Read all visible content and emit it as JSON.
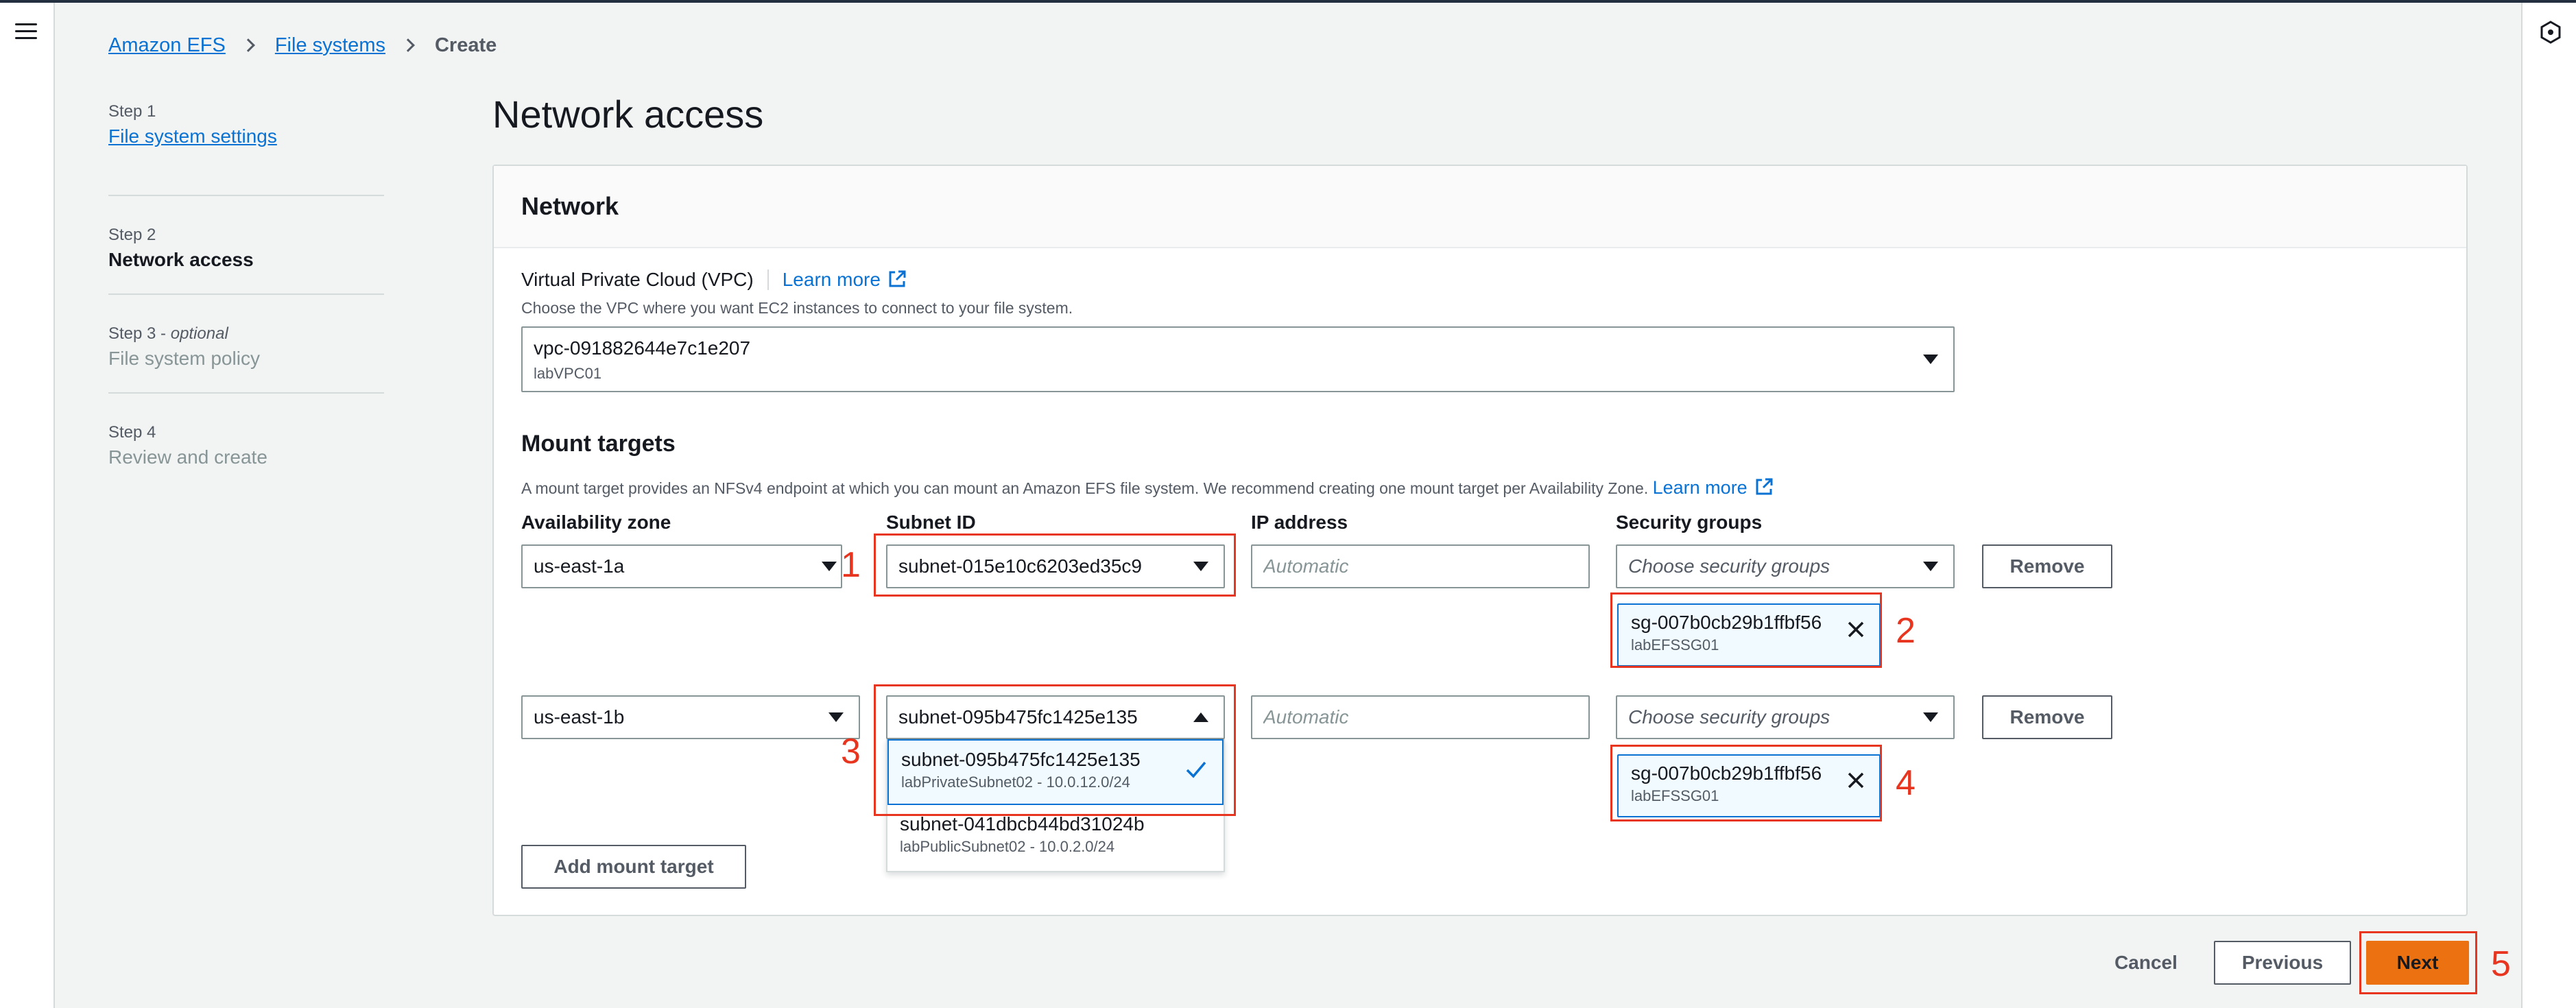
{
  "breadcrumb": {
    "items": [
      "Amazon EFS",
      "File systems"
    ],
    "current": "Create"
  },
  "steps": [
    {
      "num": "Step 1",
      "label": "File system settings",
      "state": "link"
    },
    {
      "num": "Step 2",
      "label": "Network access",
      "state": "current"
    },
    {
      "num": "Step 3",
      "optional": "optional",
      "label": "File system policy",
      "state": "disabled"
    },
    {
      "num": "Step 4",
      "label": "Review and create",
      "state": "disabled"
    }
  ],
  "page_title": "Network access",
  "network": {
    "header": "Network",
    "vpc_label": "Virtual Private Cloud (VPC)",
    "learn_more": "Learn more",
    "vpc_desc": "Choose the VPC where you want EC2 instances to connect to your file system.",
    "vpc_value": "vpc-091882644e7c1e207",
    "vpc_sub": "labVPC01"
  },
  "mount_targets": {
    "title": "Mount targets",
    "desc": "A mount target provides an NFSv4 endpoint at which you can mount an Amazon EFS file system. We recommend creating one mount target per Availability Zone.",
    "learn_more": "Learn more",
    "col_az": "Availability zone",
    "col_subnet": "Subnet ID",
    "col_ip": "IP address",
    "col_sg": "Security groups",
    "ip_placeholder": "Automatic",
    "sg_placeholder": "Choose security groups",
    "remove_label": "Remove",
    "add_label": "Add mount target",
    "rows": [
      {
        "az": "us-east-1a",
        "subnet": "subnet-015e10c6203ed35c9",
        "sg": "sg-007b0cb29b1ffbf56",
        "sg_sub": "labEFSSG01"
      },
      {
        "az": "us-east-1b",
        "subnet": "subnet-095b475fc1425e135",
        "sg": "sg-007b0cb29b1ffbf56",
        "sg_sub": "labEFSSG01"
      }
    ],
    "dropdown_options": [
      {
        "id": "subnet-095b475fc1425e135",
        "sub": "labPrivateSubnet02 - 10.0.12.0/24",
        "selected": true
      },
      {
        "id": "subnet-041dbcb44bd31024b",
        "sub": "labPublicSubnet02 - 10.0.2.0/24",
        "selected": false
      }
    ]
  },
  "footer": {
    "cancel": "Cancel",
    "previous": "Previous",
    "next": "Next"
  },
  "annotations": [
    "1",
    "2",
    "3",
    "4",
    "5"
  ],
  "colors": {
    "link": "#0972d3",
    "primary": "#ec7211",
    "annotation": "#e8351f",
    "selected_bg": "#f1faff"
  }
}
